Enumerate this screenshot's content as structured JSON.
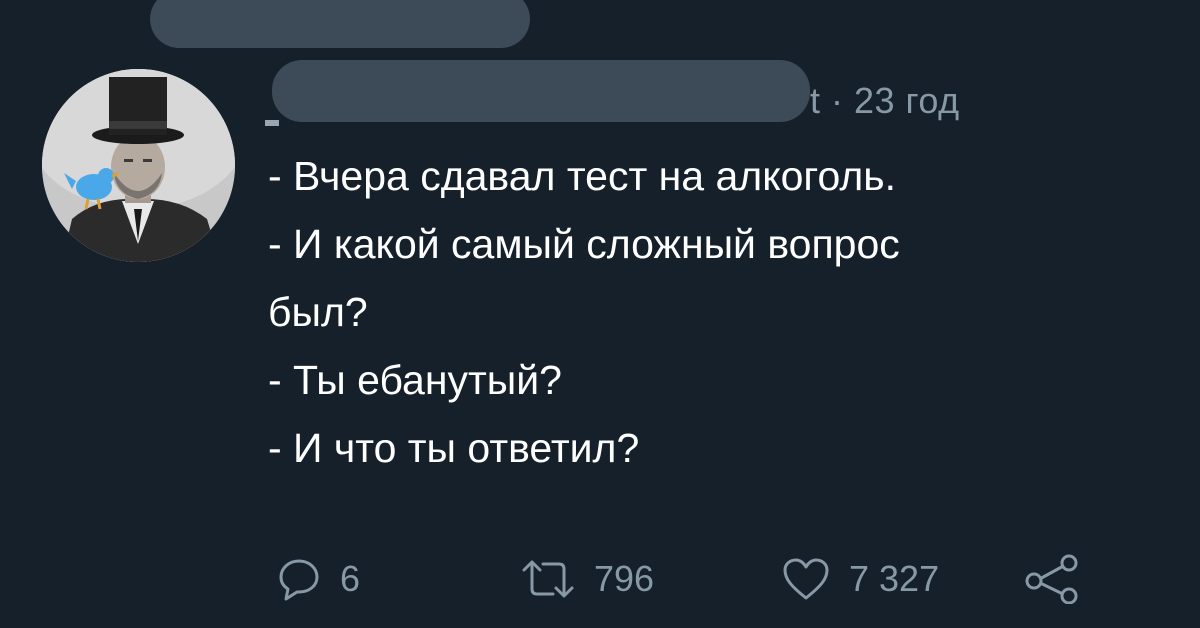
{
  "tweet": {
    "meta_suffix": "t · 23 год",
    "lines": [
      "- Вчера сдавал тест на алкоголь.",
      "- И какой самый сложный вопрос",
      "был?",
      "- Ты ебанутый?",
      "- И что ты ответил?"
    ],
    "actions": {
      "reply_count": "6",
      "retweet_count": "796",
      "like_count": "7 327"
    }
  },
  "icons": {
    "reply": "speech-bubble-icon",
    "retweet": "retweet-arrows-icon",
    "like": "heart-icon",
    "share": "share-nodes-icon"
  },
  "colors": {
    "background": "#15202b",
    "text": "#ffffff",
    "secondary": "#8899a6",
    "redaction": "#3c4b57",
    "bird": "#1da1f2"
  }
}
